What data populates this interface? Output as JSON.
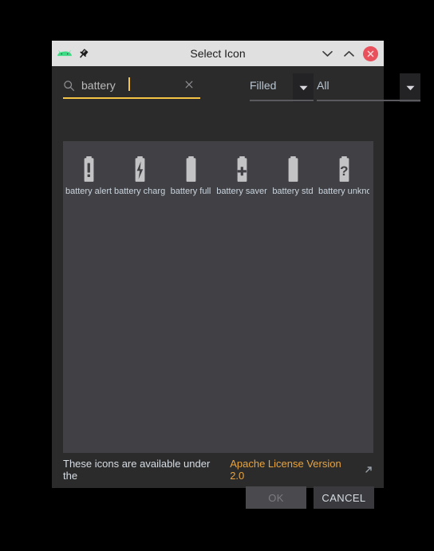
{
  "window": {
    "title": "Select Icon",
    "app_icon": "android-logo-icon",
    "pin_icon": "pin-icon",
    "controls": {
      "minimize": "chevron-down-icon",
      "maximize": "chevron-up-icon",
      "close": "close-icon"
    }
  },
  "search": {
    "icon": "search-icon",
    "value": "battery",
    "placeholder": "",
    "clear_icon": "clear-icon"
  },
  "filters": {
    "style": {
      "label": "Filled",
      "arrow_icon": "chevron-down-icon"
    },
    "category": {
      "label": "All",
      "arrow_icon": "chevron-down-icon"
    }
  },
  "icons": [
    {
      "label": "battery alert",
      "glyph": "battery-alert-icon"
    },
    {
      "label": "battery chargi",
      "glyph": "battery-charging-icon"
    },
    {
      "label": "battery full",
      "glyph": "battery-full-icon"
    },
    {
      "label": "battery saver",
      "glyph": "battery-saver-icon"
    },
    {
      "label": "battery std",
      "glyph": "battery-std-icon"
    },
    {
      "label": "battery unkno",
      "glyph": "battery-unknown-icon"
    }
  ],
  "footer": {
    "note_prefix": "These icons are available under the",
    "link_text": "Apache License Version 2.0",
    "link_arrow_icon": "external-link-icon"
  },
  "buttons": {
    "ok": "OK",
    "cancel": "CANCEL"
  },
  "colors": {
    "accent": "#f5c445",
    "link": "#e8a33d",
    "close": "#e8505c",
    "android_green": "#3ddc84",
    "panel_bg": "#414145",
    "dialog_bg": "#2b2b2b",
    "titlebar_bg": "#e0e0e0"
  }
}
